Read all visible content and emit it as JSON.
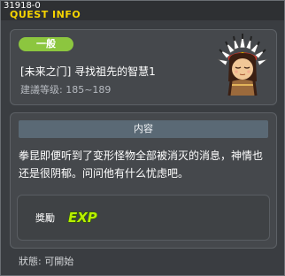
{
  "header": {
    "quest_id": "31918-0",
    "title": "QUEST INFO"
  },
  "quest": {
    "category_badge": "一般",
    "name": "[未来之门] 寻找祖先的智慧1",
    "level_range": "建議等级: 185~189"
  },
  "description": {
    "header": "内容",
    "text": "拳昆即便听到了变形怪物全部被消灭的消息，神情也还是很阴郁。问问他有什么忧虑吧。"
  },
  "reward": {
    "label": "獎勵",
    "item_icon": "exp-icon"
  },
  "status": {
    "text": "狀態: 可開始"
  },
  "colors": {
    "title": "#f6d400",
    "badge": "#8cc63f",
    "section_header": "#5a6975"
  }
}
